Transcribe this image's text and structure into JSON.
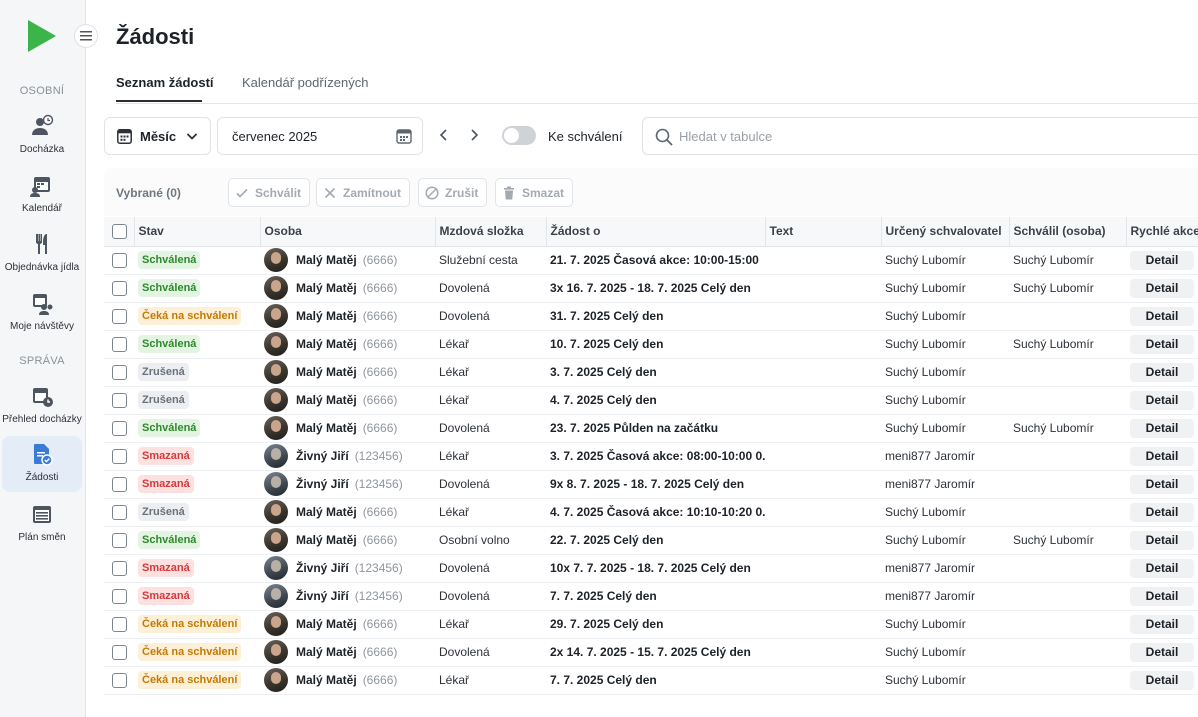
{
  "sidebar": {
    "sections": [
      {
        "title": "OSOBNÍ"
      },
      {
        "title": "SPRÁVA"
      }
    ],
    "items": [
      {
        "label": "Docházka",
        "icon": "attendance-icon"
      },
      {
        "label": "Kalendář",
        "icon": "calendar-people-icon"
      },
      {
        "label": "Objednávka jídla",
        "icon": "cutlery-icon"
      },
      {
        "label": "Moje návštěvy",
        "icon": "visits-icon"
      },
      {
        "label": "Přehled docházky",
        "icon": "attendance-overview-icon"
      },
      {
        "label": "Žádosti",
        "icon": "requests-icon"
      },
      {
        "label": "Plán směn",
        "icon": "shift-plan-icon"
      }
    ]
  },
  "page": {
    "title": "Žádosti"
  },
  "tabs": [
    {
      "label": "Seznam žádostí"
    },
    {
      "label": "Kalendář podřízených"
    }
  ],
  "toolbar": {
    "period": "Měsíc",
    "date": "červenec 2025",
    "toggle_label": "Ke schválení",
    "toggle_on": false,
    "search_placeholder": "Hledat v tabulce"
  },
  "actions": {
    "selected": "Vybrané (0)",
    "approve": "Schválit",
    "reject": "Zamítnout",
    "cancel": "Zrušit",
    "delete": "Smazat"
  },
  "table": {
    "columns": [
      "Stav",
      "Osoba",
      "Mzdová složka",
      "Žádost o",
      "Text",
      "Určený schvalovatel",
      "Schválil (osoba)",
      "Rychlé akce"
    ],
    "detail_label": "Detail",
    "rows": [
      {
        "status": "Schválená",
        "kind": "approved",
        "name": "Malý Matěj",
        "id": "(6666)",
        "wage": "Služební cesta",
        "request": "21. 7. 2025 Časová akce: 10:00-15:00",
        "text": "",
        "approver": "Suchý Lubomír",
        "approved_by": "Suchý Lubomír"
      },
      {
        "status": "Schválená",
        "kind": "approved",
        "name": "Malý Matěj",
        "id": "(6666)",
        "wage": "Dovolená",
        "request": "3x 16. 7. 2025 - 18. 7. 2025 Celý den",
        "text": "",
        "approver": "Suchý Lubomír",
        "approved_by": "Suchý Lubomír"
      },
      {
        "status": "Čeká na schválení",
        "kind": "waiting",
        "name": "Malý Matěj",
        "id": "(6666)",
        "wage": "Dovolená",
        "request": "31. 7. 2025 Celý den",
        "text": "",
        "approver": "Suchý Lubomír",
        "approved_by": ""
      },
      {
        "status": "Schválená",
        "kind": "approved",
        "name": "Malý Matěj",
        "id": "(6666)",
        "wage": "Lékař",
        "request": "10. 7. 2025 Celý den",
        "text": "",
        "approver": "Suchý Lubomír",
        "approved_by": "Suchý Lubomír"
      },
      {
        "status": "Zrušená",
        "kind": "cancelled",
        "name": "Malý Matěj",
        "id": "(6666)",
        "wage": "Lékař",
        "request": "3. 7. 2025 Celý den",
        "text": "",
        "approver": "Suchý Lubomír",
        "approved_by": ""
      },
      {
        "status": "Zrušená",
        "kind": "cancelled",
        "name": "Malý Matěj",
        "id": "(6666)",
        "wage": "Lékař",
        "request": "4. 7. 2025 Celý den",
        "text": "",
        "approver": "Suchý Lubomír",
        "approved_by": ""
      },
      {
        "status": "Schválená",
        "kind": "approved",
        "name": "Malý Matěj",
        "id": "(6666)",
        "wage": "Dovolená",
        "request": "23. 7. 2025 Půlden na začátku",
        "text": "",
        "approver": "Suchý Lubomír",
        "approved_by": "Suchý Lubomír"
      },
      {
        "status": "Smazaná",
        "kind": "deleted",
        "name": "Živný Jiří",
        "id": "(123456)",
        "wage": "Lékař",
        "request": "3. 7. 2025 Časová akce: 08:00-10:00 0...",
        "text": "",
        "approver": "meni877 Jaromír",
        "approved_by": ""
      },
      {
        "status": "Smazaná",
        "kind": "deleted",
        "name": "Živný Jiří",
        "id": "(123456)",
        "wage": "Dovolená",
        "request": "9x 8. 7. 2025 - 18. 7. 2025 Celý den",
        "text": "",
        "approver": "meni877 Jaromír",
        "approved_by": ""
      },
      {
        "status": "Zrušená",
        "kind": "cancelled",
        "name": "Malý Matěj",
        "id": "(6666)",
        "wage": "Lékař",
        "request": "4. 7. 2025 Časová akce: 10:10-10:20 0...",
        "text": "",
        "approver": "Suchý Lubomír",
        "approved_by": ""
      },
      {
        "status": "Schválená",
        "kind": "approved",
        "name": "Malý Matěj",
        "id": "(6666)",
        "wage": "Osobní volno",
        "request": "22. 7. 2025 Celý den",
        "text": "",
        "approver": "Suchý Lubomír",
        "approved_by": "Suchý Lubomír"
      },
      {
        "status": "Smazaná",
        "kind": "deleted",
        "name": "Živný Jiří",
        "id": "(123456)",
        "wage": "Dovolená",
        "request": "10x 7. 7. 2025 - 18. 7. 2025 Celý den",
        "text": "",
        "approver": "meni877 Jaromír",
        "approved_by": ""
      },
      {
        "status": "Smazaná",
        "kind": "deleted",
        "name": "Živný Jiří",
        "id": "(123456)",
        "wage": "Dovolená",
        "request": "7. 7. 2025 Celý den",
        "text": "",
        "approver": "meni877 Jaromír",
        "approved_by": ""
      },
      {
        "status": "Čeká na schválení",
        "kind": "waiting",
        "name": "Malý Matěj",
        "id": "(6666)",
        "wage": "Lékař",
        "request": "29. 7. 2025 Celý den",
        "text": "",
        "approver": "Suchý Lubomír",
        "approved_by": ""
      },
      {
        "status": "Čeká na schválení",
        "kind": "waiting",
        "name": "Malý Matěj",
        "id": "(6666)",
        "wage": "Dovolená",
        "request": "2x 14. 7. 2025 - 15. 7. 2025 Celý den",
        "text": "",
        "approver": "Suchý Lubomír",
        "approved_by": ""
      },
      {
        "status": "Čeká na schválení",
        "kind": "waiting",
        "name": "Malý Matěj",
        "id": "(6666)",
        "wage": "Lékař",
        "request": "7. 7. 2025 Celý den",
        "text": "",
        "approver": "Suchý Lubomír",
        "approved_by": ""
      }
    ]
  },
  "colors": {
    "brand": "#3bb54a",
    "active_nav": "#e4ecf7",
    "approved": "#2e8a2c",
    "waiting": "#c47a06",
    "cancelled": "#6a727c",
    "deleted": "#d33a3a"
  }
}
